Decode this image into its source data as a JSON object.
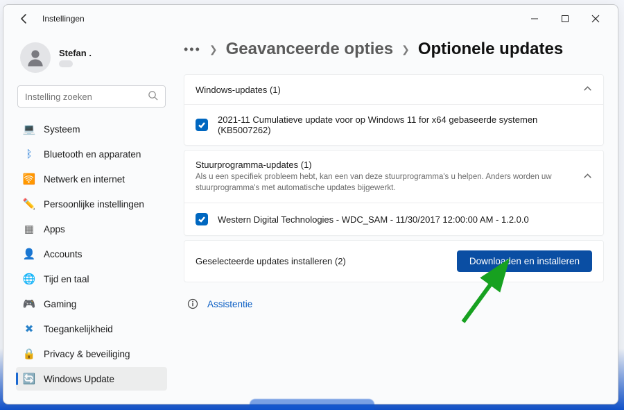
{
  "app_title": "Instellingen",
  "user": {
    "name": "Stefan ."
  },
  "search": {
    "placeholder": "Instelling zoeken"
  },
  "sidebar": {
    "items": [
      {
        "icon": "💻",
        "label": "Systeem",
        "color": "#207ad6"
      },
      {
        "icon": "ᛒ",
        "label": "Bluetooth en apparaten",
        "color": "#1f78d5"
      },
      {
        "icon": "🛜",
        "label": "Netwerk en internet",
        "color": "#2a9be0"
      },
      {
        "icon": "✏️",
        "label": "Persoonlijke instellingen",
        "color": "#c46a3b"
      },
      {
        "icon": "▦",
        "label": "Apps",
        "color": "#6a6a6a"
      },
      {
        "icon": "👤",
        "label": "Accounts",
        "color": "#5a8ac8"
      },
      {
        "icon": "🌐",
        "label": "Tijd en taal",
        "color": "#6a6a6a"
      },
      {
        "icon": "🎮",
        "label": "Gaming",
        "color": "#5a5a5a"
      },
      {
        "icon": "✖",
        "label": "Toegankelijkheid",
        "color": "#2a82c9"
      },
      {
        "icon": "🔒",
        "label": "Privacy & beveiliging",
        "color": "#5a5a5a"
      },
      {
        "icon": "🔄",
        "label": "Windows Update",
        "color": "#0d7bd6"
      }
    ],
    "active_index": 10
  },
  "breadcrumb": {
    "parent": "Geavanceerde opties",
    "current": "Optionele updates"
  },
  "sections": [
    {
      "title": "Windows-updates (1)",
      "subtitle": "",
      "items": [
        "2021-11 Cumulatieve update voor op Windows 11 for x64 gebaseerde systemen (KB5007262)"
      ]
    },
    {
      "title": "Stuurprogramma-updates (1)",
      "subtitle": "Als u een specifiek probleem hebt, kan een van deze stuurprogramma's u helpen. Anders worden uw stuurprogramma's met automatische updates bijgewerkt.",
      "items": [
        "Western Digital Technologies - WDC_SAM - 11/30/2017 12:00:00 AM - 1.2.0.0"
      ]
    }
  ],
  "install_bar": {
    "label": "Geselecteerde updates installeren (2)",
    "button": "Downloaden en installeren"
  },
  "assist": {
    "label": "Assistentie"
  },
  "colors": {
    "accent": "#0a4ea3",
    "checkbox": "#0067c0",
    "link": "#0a5ec4"
  }
}
